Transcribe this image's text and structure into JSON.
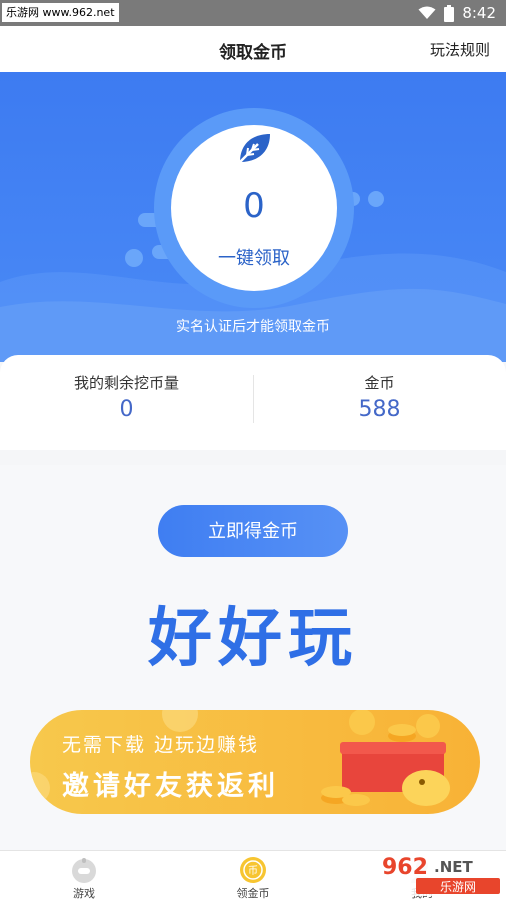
{
  "status_bar": {
    "watermark": "乐游网 www.962.net",
    "time": "8:42"
  },
  "header": {
    "title": "领取金币",
    "rules_link": "玩法规则"
  },
  "hero": {
    "coin_count": "0",
    "claim_button": "一键领取",
    "note": "实名认证后才能领取金币",
    "icon": "leaf-icon"
  },
  "stats": {
    "remaining_label": "我的剩余挖币量",
    "remaining_value": "0",
    "coins_label": "金币",
    "coins_value": "588"
  },
  "main": {
    "get_coins_button": "立即得金币",
    "big_title": "好好玩"
  },
  "banner": {
    "line1": "无需下载 边玩边赚钱",
    "line2": "邀请好友获返利"
  },
  "tabbar": {
    "items": [
      {
        "label": "游戏",
        "icon": "gamepad-icon"
      },
      {
        "label": "领金币",
        "icon": "coin-icon"
      },
      {
        "label": "我的",
        "icon": "profile-icon"
      }
    ]
  },
  "watermark_962": {
    "top": "962.NET",
    "bottom": "乐游网"
  },
  "colors": {
    "primary_blue": "#3d7bf1",
    "title_blue": "#2f6fe6",
    "banner_yellow": "#f7c84c"
  }
}
